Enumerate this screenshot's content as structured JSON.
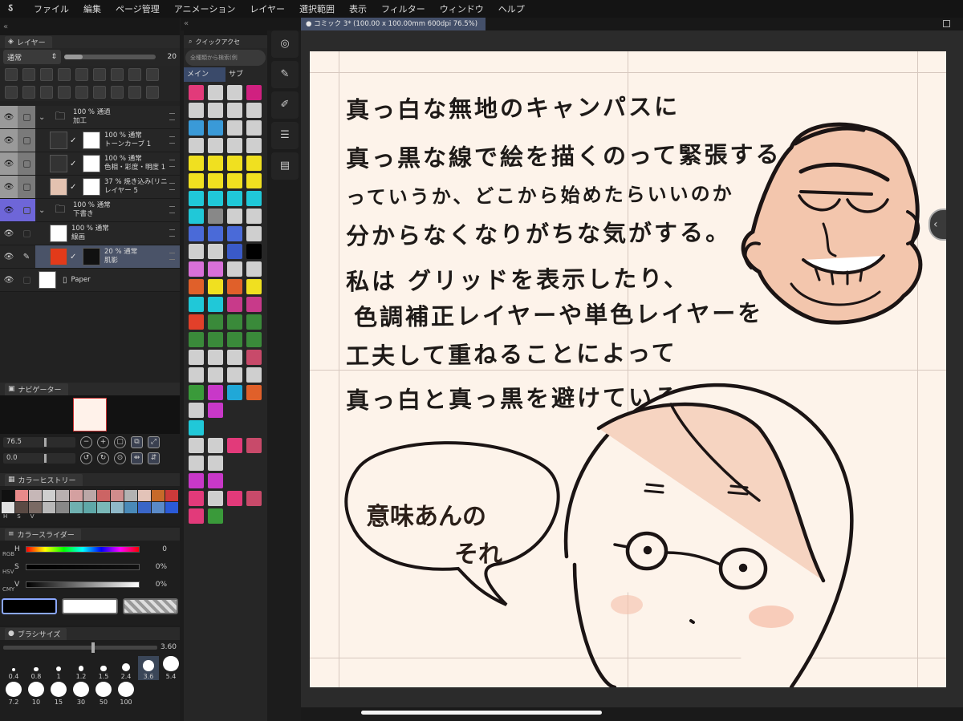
{
  "menubar": {
    "items": [
      "ファイル",
      "編集",
      "ページ管理",
      "アニメーション",
      "レイヤー",
      "選択範囲",
      "表示",
      "フィルター",
      "ウィンドウ",
      "ヘルプ"
    ]
  },
  "document_tab": {
    "title": "コミック 3* (100.00 x 100.00mm 600dpi 76.5%)"
  },
  "layer_panel": {
    "title": "レイヤー",
    "blend_mode": "通常",
    "opacity_value": "20",
    "opacity_fraction": 0.2,
    "layers": [
      {
        "line1": "100 % 通過",
        "line2": "加工",
        "type": "folder",
        "indent": 0,
        "eye_style": "gray"
      },
      {
        "line1": "100 % 通常",
        "line2": "トーンカーブ 1",
        "type": "correction",
        "indent": 1,
        "eye_style": "gray"
      },
      {
        "line1": "100 % 通常",
        "line2": "色相・彩度・明度 1",
        "type": "correction",
        "indent": 1,
        "eye_style": "gray"
      },
      {
        "line1": "37 % 焼き込み(リニ",
        "line2": "レイヤー 5",
        "type": "fill",
        "indent": 1,
        "eye_style": "gray"
      },
      {
        "line1": "100 % 通常",
        "line2": "下書き",
        "type": "folder",
        "indent": 0,
        "eye_style": "purple"
      },
      {
        "line1": "100 % 通常",
        "line2": "線画",
        "type": "raster",
        "indent": 1,
        "eye_style": "plain"
      },
      {
        "line1": "20 % 通常",
        "line2": "肌影",
        "type": "raster-selected",
        "indent": 1,
        "eye_style": "plain"
      },
      {
        "line1": "",
        "line2": "Paper",
        "type": "paper",
        "indent": 0,
        "eye_style": "plain"
      }
    ]
  },
  "navigator": {
    "title": "ナビゲーター",
    "zoom": "76.5",
    "rotation": "0.0"
  },
  "color_history": {
    "title": "カラーヒストリー",
    "swatches": [
      "#111111",
      "#e88a8a",
      "#c6b7b7",
      "#cfcfcf",
      "#b8b0b0",
      "#d4a0a0",
      "#bba7a7",
      "#cc6464",
      "#d08c8c",
      "#b2b2b2",
      "#e3c3b8",
      "#c76a2a",
      "#cc3a3a",
      "#e2e2e2",
      "#5a4a44",
      "#7a6a64",
      "#b9b9b9",
      "#888888",
      "#6fb0b0",
      "#5fa8a8",
      "#7ab8b8",
      "#8fb8c8",
      "#4a8ab8",
      "#3a66c8",
      "#5a8ac8",
      "#2a5ad8"
    ],
    "labels": [
      "H",
      "S",
      "V"
    ]
  },
  "color_slider": {
    "title": "カラースライダー",
    "modes": [
      "RGB",
      "HSV",
      "CMY"
    ],
    "h": {
      "label": "H",
      "value": "0"
    },
    "s": {
      "label": "S",
      "value": "0%"
    },
    "v": {
      "label": "V",
      "value": "0%"
    },
    "main_color": "#000000",
    "sub_color": "#ffffff"
  },
  "brush_size": {
    "title": "ブラシサイズ",
    "value": "3.60",
    "presets": [
      "0.4",
      "0.8",
      "1",
      "1.2",
      "1.5",
      "2.4",
      "3.6",
      "5.4",
      "7.2",
      "10",
      "15",
      "30",
      "50",
      "100"
    ],
    "active_preset": "3.6"
  },
  "quick_access": {
    "title": "クイックアクセ",
    "search_placeholder": "全種類から検索(例",
    "tabs": [
      "メイン",
      "サブ"
    ],
    "tool_colors": [
      "#e23a7a",
      "#cfcfcf",
      "#cfcfcf",
      "#d02080",
      "#cfcfcf",
      "#cfcfcf",
      "#cfcfcf",
      "#cfcfcf",
      "#3a9ad8",
      "#3a9ad8",
      "#cfcfcf",
      "#cfcfcf",
      "#cfcfcf",
      "#cfcfcf",
      "#cfcfcf",
      "#cfcfcf",
      "#f0e020",
      "#f0e020",
      "#f0e020",
      "#f0e020",
      "#f0e020",
      "#f0e020",
      "#f0e020",
      "#f0e020",
      "#20c8d8",
      "#20c8d8",
      "#20c8d8",
      "#20c8d8",
      "#20c8d8",
      "#888888",
      "#cfcfcf",
      "#cfcfcf",
      "#4a6ad8",
      "#4a6ad8",
      "#4a6ad8",
      "#cfcfcf",
      "#cfcfcf",
      "#cfcfcf",
      "#3a5ac8",
      "#000000",
      "#d870d8",
      "#d870d8",
      "#cfcfcf",
      "#cfcfcf",
      "#e0602a",
      "#f0e020",
      "#e0602a",
      "#f0e020",
      "#20c8d8",
      "#20c8d8",
      "#c83a8a",
      "#c83a8a",
      "#e2402a",
      "#3a8a3a",
      "#3a8a3a",
      "#3a8a3a",
      "#3a8a3a",
      "#3a8a3a",
      "#3a8a3a",
      "#3a8a3a",
      "#cfcfcf",
      "#cfcfcf",
      "#cfcfcf",
      "#c84a6a",
      "#cfcfcf",
      "#cfcfcf",
      "#cfcfcf",
      "#cfcfcf",
      "#3a9a3a",
      "#c838c8",
      "#20a8d8",
      "#e0602a",
      "#cfcfcf",
      "#c838c8",
      "#262626",
      "#262626",
      "#20c8d8",
      "#262626",
      "#262626",
      "#262626",
      "#cfcfcf",
      "#cfcfcf",
      "#e23a7a",
      "#c84a6a",
      "#cfcfcf",
      "#cfcfcf",
      "#262626",
      "#262626",
      "#c838c8",
      "#c838c8",
      "#262626",
      "#262626",
      "#e23a7a",
      "#cfcfcf",
      "#e23a7a",
      "#c84a6a",
      "#e23a7a",
      "#3a9a3a",
      "#262626",
      "#262626"
    ]
  },
  "command_bar": {
    "items": [
      "clip-studio-icon",
      "pen-icon",
      "eraser-icon",
      "sliders-icon",
      "layers-icon"
    ]
  },
  "canvas": {
    "text_lines": [
      "真っ白な無地のキャンパスに",
      "真っ黒な線で絵を描くのって緊張する",
      "っていうか、どこから始めたらいいのか",
      "分からなくなりがちな気がする。",
      "私は グリッドを表示したり、",
      "色調補正レイヤーや単色レイヤーを",
      "工夫して重ねることによって",
      "真っ白と真っ黒を避けている。"
    ],
    "speech_bubble": [
      "意味あんの",
      "それ"
    ],
    "paper_color": "#fdf3ea"
  }
}
